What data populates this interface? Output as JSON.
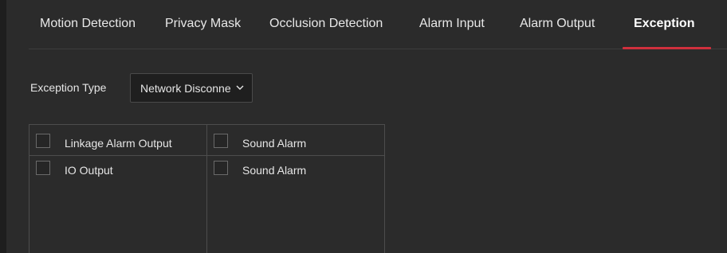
{
  "tabs": [
    {
      "label": "Motion Detection",
      "active": false
    },
    {
      "label": "Privacy Mask",
      "active": false
    },
    {
      "label": "Occlusion Detection",
      "active": false
    },
    {
      "label": "Alarm Input",
      "active": false
    },
    {
      "label": "Alarm Output",
      "active": false
    },
    {
      "label": "Exception",
      "active": true
    }
  ],
  "exception": {
    "type_label": "Exception Type",
    "type_value": "Network Disconnected",
    "chevron_icon": "chevron-down-icon"
  },
  "linkage": {
    "column1": [
      {
        "label": "Linkage Alarm Output",
        "checked": false
      },
      {
        "label": "IO Output",
        "checked": false
      }
    ],
    "column2": [
      {
        "label": "Sound Alarm",
        "checked": false
      },
      {
        "label": "Sound Alarm",
        "checked": false
      }
    ]
  },
  "colors": {
    "accent": "#d0303d",
    "background": "#2b2b2b"
  }
}
